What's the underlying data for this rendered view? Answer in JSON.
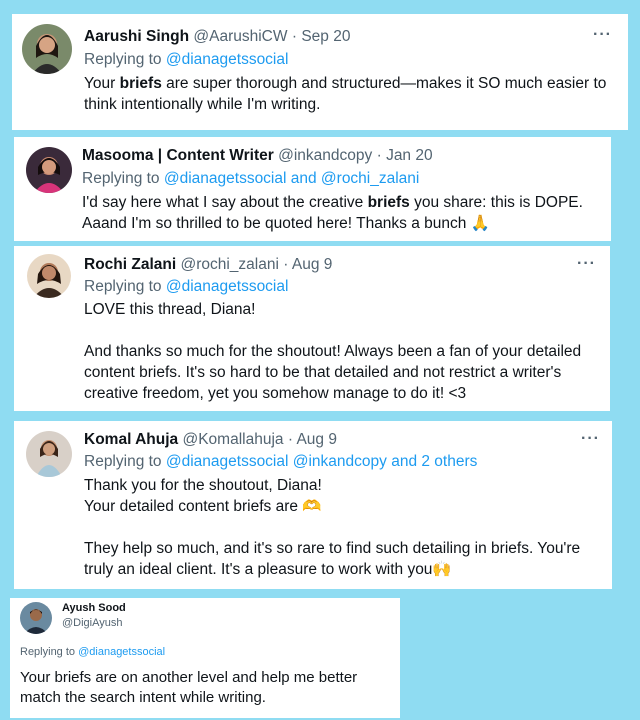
{
  "tweets": [
    {
      "name": "Aarushi Singh",
      "handle": "@AarushiCW",
      "date": "Sep 20",
      "replying_prefix": "Replying to",
      "mentions": "@dianagetssocial",
      "text_a": "Your ",
      "text_bold": "briefs",
      "text_b": " are super thorough and structured—makes it SO much easier to think intentionally while I'm writing.",
      "more": "···"
    },
    {
      "name": "Masooma | Content Writer",
      "handle": "@inkandcopy",
      "date": "Jan 20",
      "replying_prefix": "Replying to",
      "mentions": "@dianagetssocial and @rochi_zalani",
      "text_a": "I'd say here what I say about the creative ",
      "text_bold": "briefs",
      "text_b": " you share: this is DOPE. Aaand I'm so thrilled to be quoted here! Thanks a bunch 🙏"
    },
    {
      "name": "Rochi Zalani",
      "handle": "@rochi_zalani",
      "date": "Aug 9",
      "replying_prefix": "Replying to",
      "mentions": "@dianagetssocial",
      "text": "LOVE this thread, Diana!\n\nAnd thanks so much for the shoutout! Always been a fan of your detailed content briefs. It's so hard to be that detailed and not restrict a writer's creative freedom, yet you somehow manage to do it! <3",
      "more": "···"
    },
    {
      "name": "Komal Ahuja",
      "handle": "@Komallahuja",
      "date": "Aug 9",
      "replying_prefix": "Replying to",
      "mentions": "@dianagetssocial @inkandcopy and 2 others",
      "text": "Thank you for the shoutout, Diana!\nYour detailed content briefs are 🫶\n\nThey help so much, and it's so rare to find such detailing in briefs. You're truly an ideal client. It's a pleasure to work with you🙌",
      "more": "···"
    },
    {
      "name": "Ayush Sood",
      "handle": "@DigiAyush",
      "replying_prefix": "Replying to",
      "mentions": "@dianagetssocial",
      "text": "Your briefs are on another level and help me better match the search intent while writing."
    }
  ]
}
